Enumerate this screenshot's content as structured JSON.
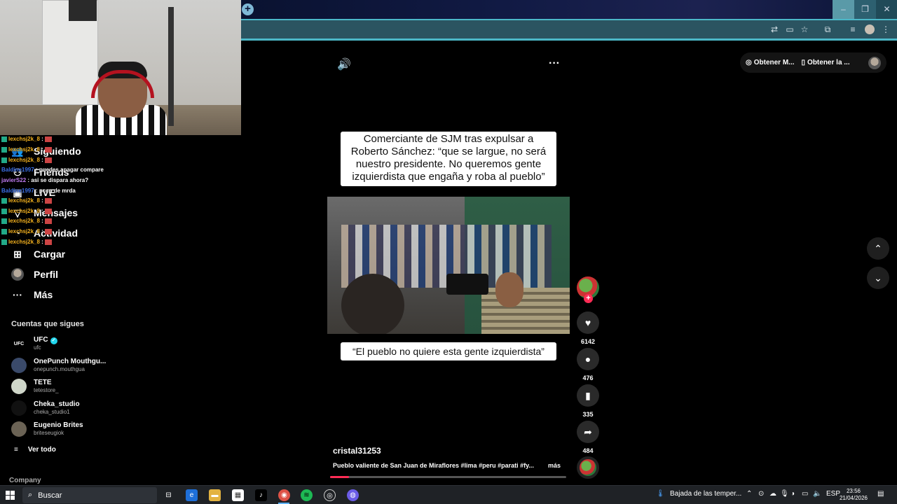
{
  "browser": {
    "new_tab_icon": "plus-icon",
    "window_controls": [
      "minimize",
      "maximize",
      "close"
    ]
  },
  "top_bar": {
    "obtain_app_label": "Obtener M...",
    "obtain_desktop_label": "Obtener la ..."
  },
  "sidebar": {
    "nav": [
      {
        "label": "Siguiendo",
        "icon": "following-icon"
      },
      {
        "label": "Friends",
        "icon": "friends-icon"
      },
      {
        "label": "LIVE",
        "icon": "live-icon"
      },
      {
        "label": "Mensajes",
        "icon": "messages-icon"
      },
      {
        "label": "Actividad",
        "icon": "activity-icon"
      },
      {
        "label": "Cargar",
        "icon": "upload-icon"
      },
      {
        "label": "Perfil",
        "icon": "avatar-icon"
      },
      {
        "label": "Más",
        "icon": "more-icon"
      }
    ],
    "following_title": "Cuentas que sigues",
    "following": [
      {
        "name": "UFC",
        "handle": "ufc",
        "verified": true,
        "avatar_text": "UFC"
      },
      {
        "name": "OnePunch Mouthgu...",
        "handle": "onepunch.mouthgua",
        "verified": false,
        "avatar_text": ""
      },
      {
        "name": "TETE",
        "handle": "tetestore_",
        "verified": false,
        "avatar_text": ""
      },
      {
        "name": "Cheka_studio",
        "handle": "cheka_studio1",
        "verified": false,
        "avatar_text": ""
      },
      {
        "name": "Eugenio Brites",
        "handle": "briteseugiok",
        "verified": false,
        "avatar_text": ""
      }
    ],
    "see_all": "Ver todo",
    "company": "Company"
  },
  "chat": [
    {
      "user": "lexchsj2k_8",
      "text": ":",
      "color": "u1"
    },
    {
      "user": "lexchsj2k_8",
      "text": ":",
      "color": "u1"
    },
    {
      "user": "lexchsj2k_8",
      "text": ":",
      "color": "u1"
    },
    {
      "user": "Baldine1997",
      "text": ": puedes apagar compare",
      "color": "u2"
    },
    {
      "user": "javierS22",
      "text": ": asi se dispara ahora?",
      "color": "u3"
    },
    {
      "user": "Baldine1997",
      "text": ": pccp de mrda",
      "color": "u2"
    },
    {
      "user": "lexchsj2k_8",
      "text": ":",
      "color": "u1"
    },
    {
      "user": "lexchsj2k_8",
      "text": ":",
      "color": "u1"
    },
    {
      "user": "lexchsj2k_8",
      "text": ":",
      "color": "u1"
    },
    {
      "user": "lexchsj2k_8",
      "text": ":",
      "color": "u1"
    },
    {
      "user": "lexchsj2k_8",
      "text": ":",
      "color": "u1"
    }
  ],
  "video": {
    "caption": "Comerciante de SJM tras expulsar a Roberto Sánchez: “que se largue, no será nuestro presidente. No queremos gente izquierdista que engaña y roba al pueblo”",
    "subcaption": "“El pueblo no quiere esta gente izquierdista”",
    "author": "cristal31253",
    "description": "Pueblo valiente de San Juan de Miraflores #lima #peru #parati #fy...",
    "more_label": "más",
    "progress": 0.08
  },
  "actions": {
    "likes": "6142",
    "comments": "476",
    "saves": "335",
    "shares": "484"
  },
  "taskbar": {
    "search_placeholder": "Buscar",
    "weather": "Bajada de las temper...",
    "lang": "ESP",
    "time": "23:56",
    "date": "21/04/2026"
  },
  "colors": {
    "accent": "#fe2c55",
    "browser_teal": "#4cb8c8",
    "verified": "#20d5ec"
  }
}
